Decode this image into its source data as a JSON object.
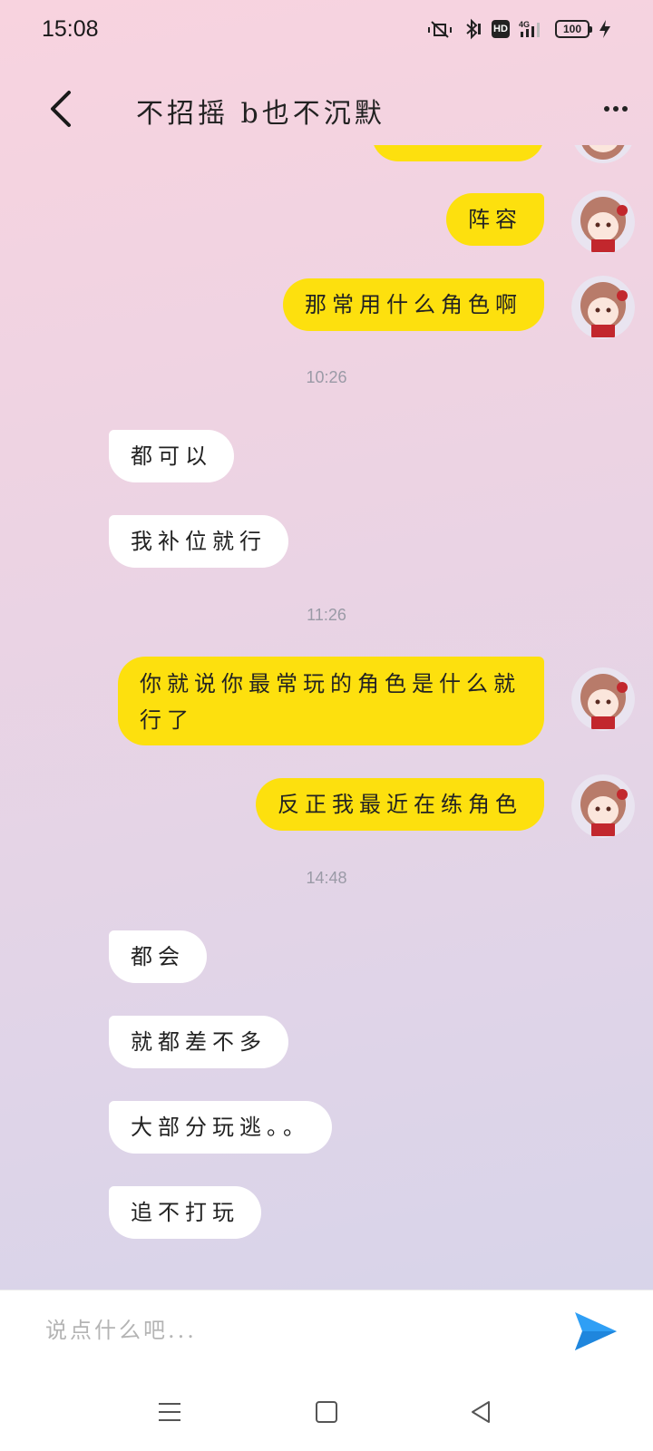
{
  "status_bar": {
    "time": "15:08",
    "battery": "100"
  },
  "header": {
    "title": "不招摇 b也不沉默"
  },
  "messages": {
    "m1": "阵容",
    "m2": "那常用什么角色啊",
    "t1": "10:26",
    "m3": "都可以",
    "m4": "我补位就行",
    "t2": "11:26",
    "m5": "你就说你最常玩的角色是什么就行了",
    "m6": "反正我最近在练角色",
    "t3": "14:48",
    "m7": "都会",
    "m8": "就都差不多",
    "m9": "大部分玩逃。。",
    "m10": "追不打玩"
  },
  "input": {
    "placeholder": "说点什么吧..."
  },
  "colors": {
    "my_bubble": "#fde00e",
    "their_bubble": "#ffffff",
    "send": "#2f9ff5"
  }
}
